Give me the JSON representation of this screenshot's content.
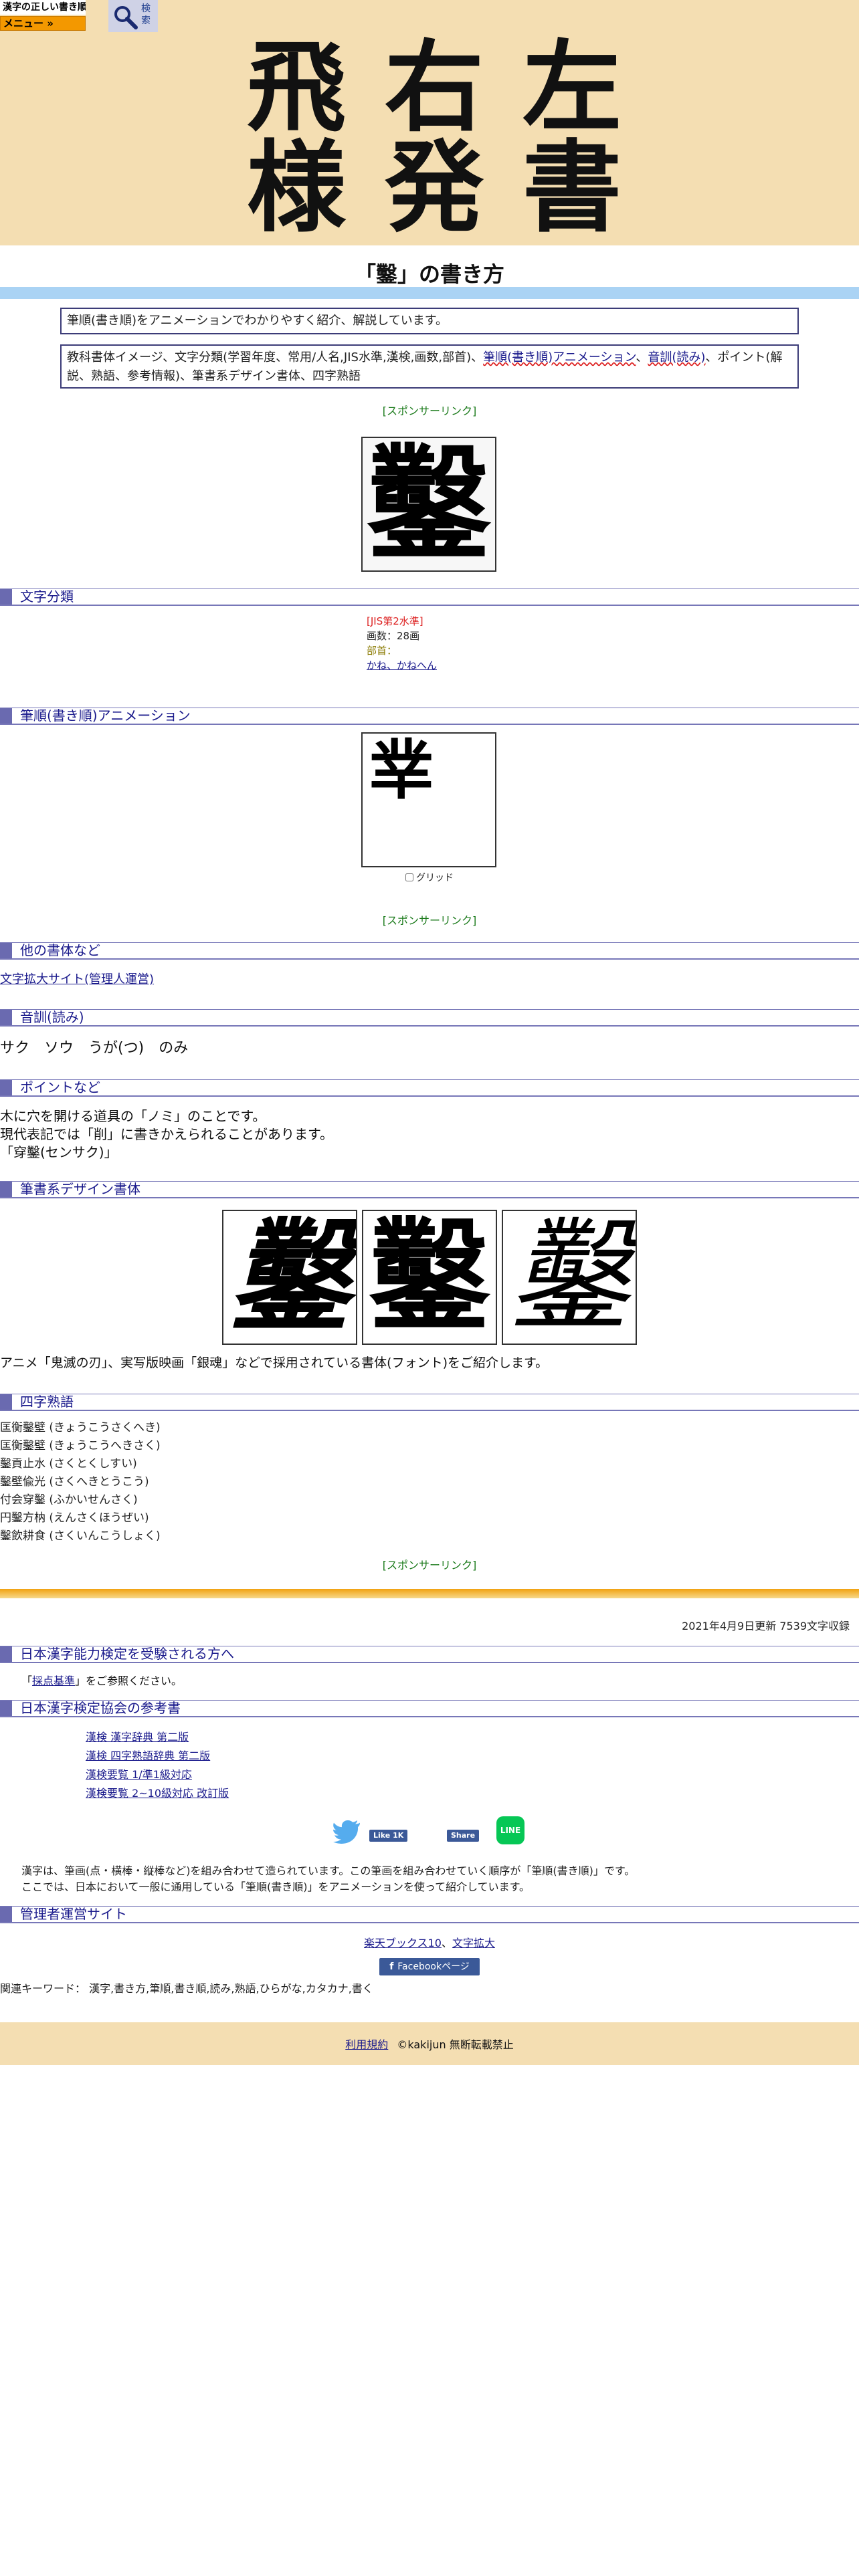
{
  "topbar": {
    "logo_text": "漢字の正しい書き順(筆順)",
    "menu_label": "メニュー »",
    "search_label": "検索"
  },
  "header": {
    "title_chars": [
      "飛",
      "右",
      "左",
      "様",
      "発",
      "書"
    ]
  },
  "page_title": "「鑿」の書き方",
  "intro": {
    "summary": "筆順(書き順)をアニメーションでわかりやすく紹介、解説しています。",
    "contents_part1": "教科書体イメージ、文字分類(学習年度、常用/人名,JIS水準,漢検,画数,部首)、",
    "contents_link1": "筆順(書き順)アニメーション",
    "contents_sep": "、",
    "contents_link2": "音訓(読み)",
    "contents_part2": "、ポイント(解説、熟語、参考情報)、筆書系デザイン書体、四字熟語"
  },
  "sponsor_label": "[スポンサーリンク]",
  "kanji": "鑿",
  "animation_frame_char": "丵",
  "classification": {
    "heading": "文字分類",
    "jis": "[JIS第2水準]",
    "strokes": "画数：28画",
    "radical_label": "部首：",
    "radical": "かね、かねへん"
  },
  "animation": {
    "heading": "筆順(書き順)アニメーション",
    "grid_label": "グリッド"
  },
  "other_fonts": {
    "heading": "他の書体など",
    "link": "文字拡大サイト(管理人運営)"
  },
  "readings": {
    "heading": "音訓(読み)",
    "values": [
      "サク",
      "ソウ",
      "うが(つ)",
      "のみ"
    ]
  },
  "points": {
    "heading": "ポイントなど",
    "lines": [
      "木に穴を開ける道具の「ノミ」のことです。",
      "現代表記では「削」に書きかえられることがあります。",
      "「穿鑿(センサク)」"
    ]
  },
  "design": {
    "heading": "筆書系デザイン書体",
    "caption": "アニメ「鬼滅の刃」、実写版映画「銀魂」などで採用されている書体(フォント)をご紹介します。"
  },
  "idioms": {
    "heading": "四字熟語",
    "items": [
      "匡衡鑿壁 (きょうこうさくへき)",
      "匡衡鑿壁 (きょうこうへきさく)",
      "鑿貢止水 (さくとくしすい)",
      "鑿壁偸光 (さくへきとうこう)",
      "付会穿鑿 (ふかいせんさく)",
      "円鑿方枘 (えんさくほうぜい)",
      "鑿飲耕食 (さくいんこうしょく)"
    ]
  },
  "updated": "2021年4月9日更新 7539文字収録",
  "kanken_exam": {
    "heading": "日本漢字能力検定を受験される方へ",
    "open": "「",
    "link": "採点基準",
    "close": "」をご参照ください。"
  },
  "references": {
    "heading": "日本漢字検定協会の参考書",
    "items": [
      "漢検 漢字辞典 第二版",
      "漢検 四字熟語辞典 第二版",
      "漢検要覧 1/準1級対応",
      "漢検要覧 2~10級対応 改訂版"
    ]
  },
  "share": {
    "like_label": "Like 1K",
    "share_label": "Share",
    "line_label": "LINE"
  },
  "explain": {
    "line1": "漢字は、筆画(点・横棒・縦棒など)を組み合わせて造られています。この筆画を組み合わせていく順序が「筆順(書き順)」です。",
    "line2": "ここでは、日本において一般に通用している「筆順(書き順)」をアニメーションを使って紹介しています。"
  },
  "admin": {
    "heading": "管理者運営サイト",
    "link1": "楽天ブックス10",
    "sep": "、",
    "link2": "文字拡大",
    "fb_page": "Facebookページ"
  },
  "keywords": "関連キーワード： 漢字,書き方,筆順,書き順,読み,熟語,ひらがな,カタカナ,書く",
  "footer": {
    "terms": "利用規約",
    "copyright": "©kakijun 無断転載禁止"
  }
}
